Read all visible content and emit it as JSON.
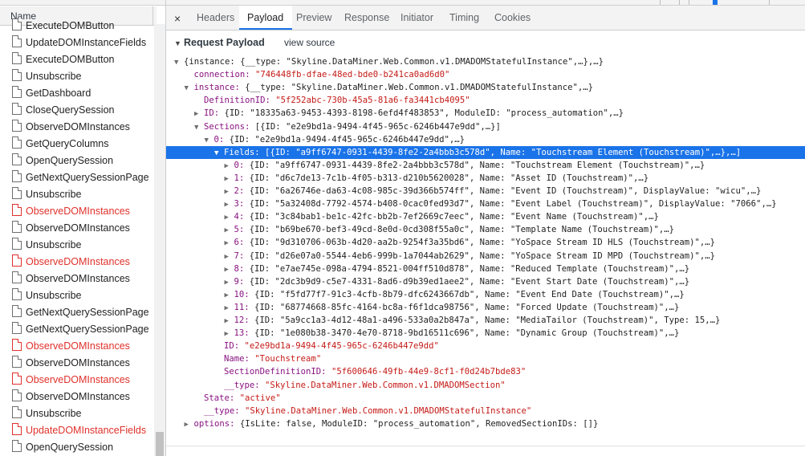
{
  "left_panel": {
    "header": "Name",
    "rows": [
      {
        "label": "ExecuteDOMButton",
        "error": false
      },
      {
        "label": "UpdateDOMInstanceFields",
        "error": false
      },
      {
        "label": "ExecuteDOMButton",
        "error": false
      },
      {
        "label": "Unsubscribe",
        "error": false
      },
      {
        "label": "GetDashboard",
        "error": false
      },
      {
        "label": "CloseQuerySession",
        "error": false
      },
      {
        "label": "ObserveDOMInstances",
        "error": false
      },
      {
        "label": "GetQueryColumns",
        "error": false
      },
      {
        "label": "OpenQuerySession",
        "error": false
      },
      {
        "label": "GetNextQuerySessionPage",
        "error": false
      },
      {
        "label": "Unsubscribe",
        "error": false
      },
      {
        "label": "ObserveDOMInstances",
        "error": true
      },
      {
        "label": "ObserveDOMInstances",
        "error": false
      },
      {
        "label": "Unsubscribe",
        "error": false
      },
      {
        "label": "ObserveDOMInstances",
        "error": true
      },
      {
        "label": "ObserveDOMInstances",
        "error": false
      },
      {
        "label": "Unsubscribe",
        "error": false
      },
      {
        "label": "GetNextQuerySessionPage",
        "error": false
      },
      {
        "label": "GetNextQuerySessionPage",
        "error": false
      },
      {
        "label": "ObserveDOMInstances",
        "error": true
      },
      {
        "label": "ObserveDOMInstances",
        "error": false
      },
      {
        "label": "ObserveDOMInstances",
        "error": true
      },
      {
        "label": "ObserveDOMInstances",
        "error": false
      },
      {
        "label": "Unsubscribe",
        "error": false
      },
      {
        "label": "UpdateDOMInstanceFields",
        "error": true
      },
      {
        "label": "OpenQuerySession",
        "error": false
      }
    ]
  },
  "tabs": {
    "close": "×",
    "items": [
      "Headers",
      "Payload",
      "Preview",
      "Response",
      "Initiator",
      "Timing",
      "Cookies"
    ],
    "active": "Payload"
  },
  "payload": {
    "section_title": "Request Payload",
    "view_source": "view source",
    "lines": [
      {
        "indent": 0,
        "tri": "down",
        "segs": [
          [
            "p",
            "{instance: {__type: \"Skyline.DataMiner.Web.Common.v1.DMADOMStatefulInstance\",…},…}"
          ]
        ]
      },
      {
        "indent": 1,
        "tri": "",
        "segs": [
          [
            "k",
            "connection: "
          ],
          [
            "s",
            "\"746448fb-dfae-48ed-bde0-b241ca0ad6d0\""
          ]
        ]
      },
      {
        "indent": 1,
        "tri": "down",
        "segs": [
          [
            "k",
            "instance: "
          ],
          [
            "p",
            "{__type: \"Skyline.DataMiner.Web.Common.v1.DMADOMStatefulInstance\",…}"
          ]
        ]
      },
      {
        "indent": 2,
        "tri": "",
        "segs": [
          [
            "k",
            "DefinitionID: "
          ],
          [
            "s",
            "\"5f252abc-730b-45a5-81a6-fa3441cb4095\""
          ]
        ]
      },
      {
        "indent": 2,
        "tri": "right",
        "segs": [
          [
            "k",
            "ID: "
          ],
          [
            "p",
            "{ID: \"18335a63-9453-4393-8198-6efd4f483853\", ModuleID: \"process_automation\",…}"
          ]
        ]
      },
      {
        "indent": 2,
        "tri": "down",
        "segs": [
          [
            "k",
            "Sections: "
          ],
          [
            "p",
            "[{ID: \"e2e9bd1a-9494-4f45-965c-6246b447e9dd\",…}]"
          ]
        ]
      },
      {
        "indent": 3,
        "tri": "down",
        "segs": [
          [
            "k",
            "0: "
          ],
          [
            "p",
            "{ID: \"e2e9bd1a-9494-4f45-965c-6246b447e9dd\",…}"
          ]
        ]
      },
      {
        "indent": 4,
        "tri": "down",
        "selected": true,
        "segs": [
          [
            "k",
            "Fields: "
          ],
          [
            "p",
            "[{ID: \"a9ff6747-0931-4439-8fe2-2a4bbb3c578d\", Name: \"Touchstream Element (Touchstream)\",…},…]"
          ]
        ]
      },
      {
        "indent": 5,
        "tri": "right",
        "segs": [
          [
            "k",
            "0: "
          ],
          [
            "p",
            "{ID: \"a9ff6747-0931-4439-8fe2-2a4bbb3c578d\", Name: \"Touchstream Element (Touchstream)\",…}"
          ]
        ]
      },
      {
        "indent": 5,
        "tri": "right",
        "segs": [
          [
            "k",
            "1: "
          ],
          [
            "p",
            "{ID: \"d6c7de13-7c1b-4f05-b313-d210b5620028\", Name: \"Asset ID (Touchstream)\",…}"
          ]
        ]
      },
      {
        "indent": 5,
        "tri": "right",
        "segs": [
          [
            "k",
            "2: "
          ],
          [
            "p",
            "{ID: \"6a26746e-da63-4c08-985c-39d366b574ff\", Name: \"Event ID (Touchstream)\", DisplayValue: \"wicu\",…}"
          ]
        ]
      },
      {
        "indent": 5,
        "tri": "right",
        "segs": [
          [
            "k",
            "3: "
          ],
          [
            "p",
            "{ID: \"5a32408d-7792-4574-b408-0cac0fed93d7\", Name: \"Event Label (Touchstream)\", DisplayValue: \"7066\",…}"
          ]
        ]
      },
      {
        "indent": 5,
        "tri": "right",
        "segs": [
          [
            "k",
            "4: "
          ],
          [
            "p",
            "{ID: \"3c84bab1-be1c-42fc-bb2b-7ef2669c7eec\", Name: \"Event Name (Touchstream)\",…}"
          ]
        ]
      },
      {
        "indent": 5,
        "tri": "right",
        "segs": [
          [
            "k",
            "5: "
          ],
          [
            "p",
            "{ID: \"b69be670-bef3-49cd-8e0d-0cd308f55a0c\", Name: \"Template Name (Touchstream)\",…}"
          ]
        ]
      },
      {
        "indent": 5,
        "tri": "right",
        "segs": [
          [
            "k",
            "6: "
          ],
          [
            "p",
            "{ID: \"9d310706-063b-4d20-aa2b-9254f3a35bd6\", Name: \"YoSpace Stream ID HLS (Touchstream)\",…}"
          ]
        ]
      },
      {
        "indent": 5,
        "tri": "right",
        "segs": [
          [
            "k",
            "7: "
          ],
          [
            "p",
            "{ID: \"d26e07a0-5544-4eb6-999b-1a7044ab2629\", Name: \"YoSpace Stream ID MPD (Touchstream)\",…}"
          ]
        ]
      },
      {
        "indent": 5,
        "tri": "right",
        "segs": [
          [
            "k",
            "8: "
          ],
          [
            "p",
            "{ID: \"e7ae745e-098a-4794-8521-004ff510d878\", Name: \"Reduced Template (Touchstream)\",…}"
          ]
        ]
      },
      {
        "indent": 5,
        "tri": "right",
        "segs": [
          [
            "k",
            "9: "
          ],
          [
            "p",
            "{ID: \"2dc3b9d9-c5e7-4331-8ad6-d9b39ed1aee2\", Name: \"Event Start Date (Touchstream)\",…}"
          ]
        ]
      },
      {
        "indent": 5,
        "tri": "right",
        "segs": [
          [
            "k",
            "10: "
          ],
          [
            "p",
            "{ID: \"f5fd77f7-91c3-4cfb-8b79-dfc6243667db\", Name: \"Event End Date (Touchstream)\",…}"
          ]
        ]
      },
      {
        "indent": 5,
        "tri": "right",
        "segs": [
          [
            "k",
            "11: "
          ],
          [
            "p",
            "{ID: \"68774668-85fc-4164-bc8a-f6f1dca98756\", Name: \"Forced Update (Touchstream)\",…}"
          ]
        ]
      },
      {
        "indent": 5,
        "tri": "right",
        "segs": [
          [
            "k",
            "12: "
          ],
          [
            "p",
            "{ID: \"5a9cc1a3-4d12-48a1-a496-533a0a2b847a\", Name: \"MediaTailor (Touchstream)\", Type: 15,…}"
          ]
        ]
      },
      {
        "indent": 5,
        "tri": "right",
        "segs": [
          [
            "k",
            "13: "
          ],
          [
            "p",
            "{ID: \"1e080b38-3470-4e70-8718-9bd16511c696\", Name: \"Dynamic Group (Touchstream)\",…}"
          ]
        ]
      },
      {
        "indent": 4,
        "tri": "",
        "segs": [
          [
            "k",
            "ID: "
          ],
          [
            "s",
            "\"e2e9bd1a-9494-4f45-965c-6246b447e9dd\""
          ]
        ]
      },
      {
        "indent": 4,
        "tri": "",
        "segs": [
          [
            "k",
            "Name: "
          ],
          [
            "s",
            "\"Touchstream\""
          ]
        ]
      },
      {
        "indent": 4,
        "tri": "",
        "segs": [
          [
            "k",
            "SectionDefinitionID: "
          ],
          [
            "s",
            "\"5f600646-49fb-44e9-8cf1-f0d24b7bde83\""
          ]
        ]
      },
      {
        "indent": 4,
        "tri": "",
        "segs": [
          [
            "k",
            "__type: "
          ],
          [
            "s",
            "\"Skyline.DataMiner.Web.Common.v1.DMADOMSection\""
          ]
        ]
      },
      {
        "indent": 2,
        "tri": "",
        "segs": [
          [
            "k",
            "State: "
          ],
          [
            "s",
            "\"active\""
          ]
        ]
      },
      {
        "indent": 2,
        "tri": "",
        "segs": [
          [
            "k",
            "__type: "
          ],
          [
            "s",
            "\"Skyline.DataMiner.Web.Common.v1.DMADOMStatefulInstance\""
          ]
        ]
      },
      {
        "indent": 1,
        "tri": "right",
        "segs": [
          [
            "k",
            "options: "
          ],
          [
            "p",
            "{IsLite: false, ModuleID: \"process_automation\", RemovedSectionIDs: []}"
          ]
        ]
      }
    ]
  }
}
